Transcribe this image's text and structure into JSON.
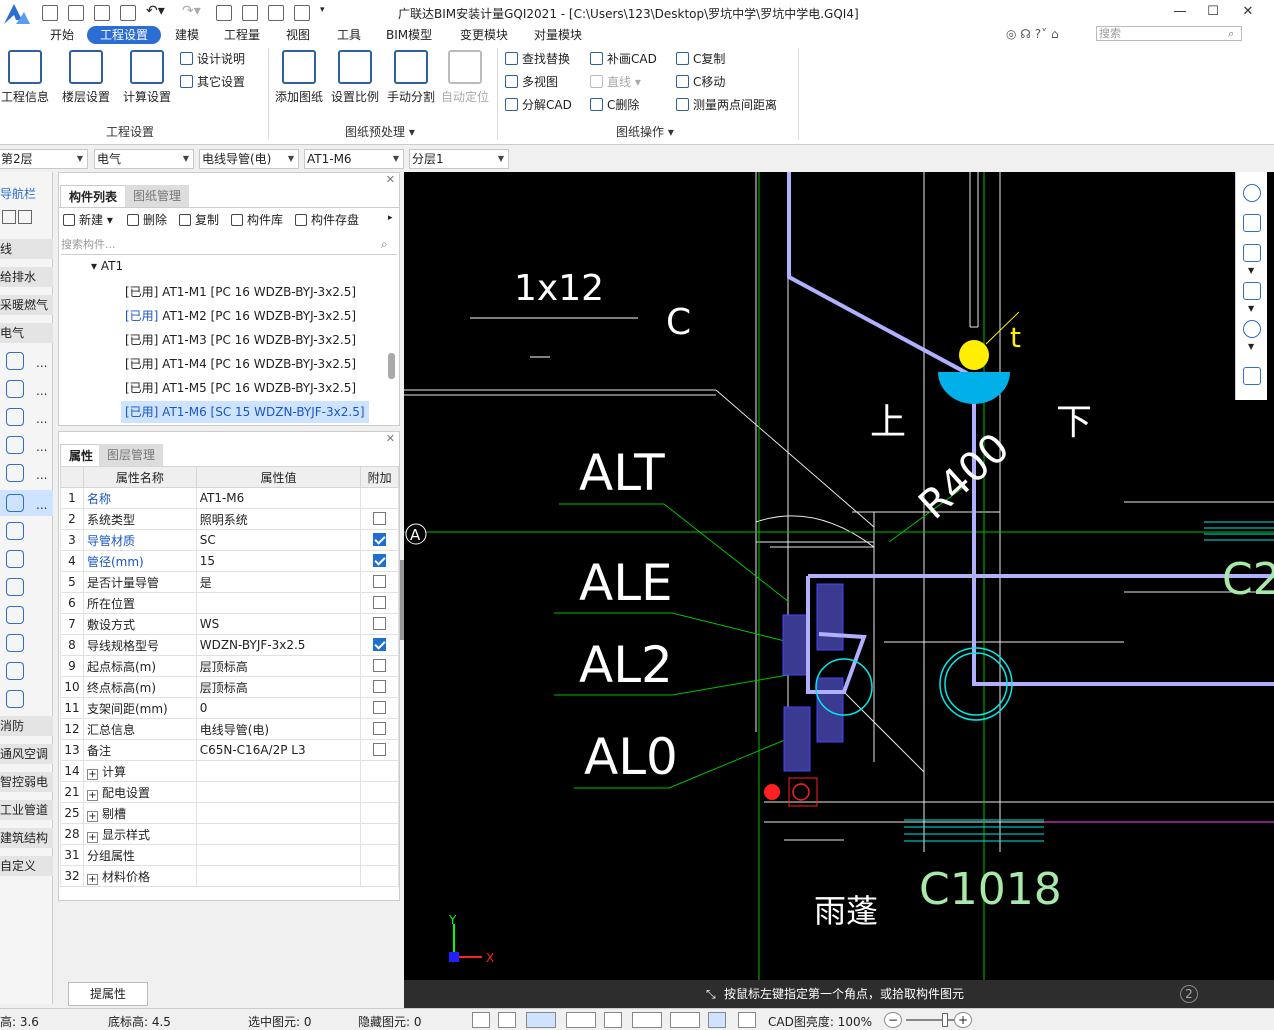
{
  "window": {
    "title": "广联达BIM安装计量GQI2021 - [C:\\Users\\123\\Desktop\\罗坑中学\\罗坑中学电.GQI4]",
    "search_placeholder": "搜索"
  },
  "menu": [
    "开始",
    "工程设置",
    "建模",
    "工程量",
    "视图",
    "工具",
    "BIM模型",
    "变更模块",
    "对量模块"
  ],
  "menu_active": "工程设置",
  "ribbon": {
    "group1": {
      "buttons": [
        "工程信息",
        "楼层设置",
        "计算设置"
      ],
      "small": [
        "设计说明",
        "其它设置"
      ],
      "label": "工程设置"
    },
    "group2": {
      "buttons": [
        "添加图纸",
        "设置比例",
        "手动分割",
        "自动定位"
      ],
      "label": "图纸预处理"
    },
    "group3": {
      "col1": [
        "查找替换",
        "多视图",
        "分解CAD"
      ],
      "col2": [
        "补画CAD",
        "直线",
        "C删除"
      ],
      "col3": [
        "C复制",
        "C移动",
        "测量两点间距离"
      ],
      "label": "图纸操作"
    }
  },
  "combos": [
    "第2层",
    "电气",
    "电线导管(电)",
    "AT1-M6",
    "分层1"
  ],
  "nav": {
    "title": "导航栏",
    "items": [
      "线",
      "给排水",
      "采暖燃气",
      "电气"
    ],
    "bottom_items": [
      "消防",
      "通风空调",
      "智控弱电",
      "工业管道",
      "建筑结构",
      "自定义"
    ],
    "dots": "..."
  },
  "component_list": {
    "tabs": [
      "构件列表",
      "图纸管理"
    ],
    "toolbar": [
      "新建",
      "删除",
      "复制",
      "构件库",
      "构件存盘"
    ],
    "search_placeholder": "搜索构件...",
    "root": "AT1",
    "items": [
      "[已用] AT1-M1 [PC 16 WDZB-BYJ-3x2.5]",
      "[已用] AT1-M2 [PC 16 WDZB-BYJ-3x2.5]",
      "[已用] AT1-M3 [PC 16 WDZB-BYJ-3x2.5]",
      "[已用] AT1-M4 [PC 16 WDZB-BYJ-3x2.5]",
      "[已用] AT1-M5 [PC 16 WDZB-BYJ-3x2.5]",
      "[已用] AT1-M6 [SC 15 WDZN-BYJF-3x2.5]"
    ]
  },
  "properties": {
    "tabs": [
      "属性",
      "图层管理"
    ],
    "headers": [
      "属性名称",
      "属性值",
      "附加"
    ],
    "rows": [
      {
        "n": "1",
        "k": "名称",
        "v": "AT1-M6",
        "blue": true,
        "cb": "none"
      },
      {
        "n": "2",
        "k": "系统类型",
        "v": "照明系统",
        "blue": false,
        "cb": "off"
      },
      {
        "n": "3",
        "k": "导管材质",
        "v": "SC",
        "blue": true,
        "cb": "on"
      },
      {
        "n": "4",
        "k": "管径(mm)",
        "v": "15",
        "blue": true,
        "cb": "on"
      },
      {
        "n": "5",
        "k": "是否计量导管",
        "v": "是",
        "blue": false,
        "cb": "off"
      },
      {
        "n": "6",
        "k": "所在位置",
        "v": "",
        "blue": false,
        "cb": "off"
      },
      {
        "n": "7",
        "k": "敷设方式",
        "v": "WS",
        "blue": false,
        "cb": "off"
      },
      {
        "n": "8",
        "k": "导线规格型号",
        "v": "WDZN-BYJF-3x2.5",
        "blue": false,
        "cb": "on"
      },
      {
        "n": "9",
        "k": "起点标高(m)",
        "v": "层顶标高",
        "blue": false,
        "cb": "off"
      },
      {
        "n": "10",
        "k": "终点标高(m)",
        "v": "层顶标高",
        "blue": false,
        "cb": "off"
      },
      {
        "n": "11",
        "k": "支架间距(mm)",
        "v": "0",
        "blue": false,
        "cb": "off"
      },
      {
        "n": "12",
        "k": "汇总信息",
        "v": "电线导管(电)",
        "blue": false,
        "cb": "off"
      },
      {
        "n": "13",
        "k": "备注",
        "v": "C65N-C16A/2P L3",
        "blue": false,
        "cb": "off"
      },
      {
        "n": "14",
        "k": "计算",
        "v": "",
        "blue": false,
        "cb": "none",
        "expand": true
      },
      {
        "n": "21",
        "k": "配电设置",
        "v": "",
        "blue": false,
        "cb": "none",
        "expand": true
      },
      {
        "n": "25",
        "k": "剔槽",
        "v": "",
        "blue": false,
        "cb": "none",
        "expand": true
      },
      {
        "n": "28",
        "k": "显示样式",
        "v": "",
        "blue": false,
        "cb": "none",
        "expand": true
      },
      {
        "n": "31",
        "k": "分组属性",
        "v": "",
        "blue": false,
        "cb": "none"
      },
      {
        "n": "32",
        "k": "材料价格",
        "v": "",
        "blue": false,
        "cb": "none",
        "expand": true
      }
    ],
    "button": "提属性"
  },
  "canvas": {
    "labels": [
      "1x12",
      "C",
      "ALT",
      "ALE",
      "AL2",
      "AL0",
      "R400",
      "C1018",
      "雨蓬",
      "上",
      "下",
      "t",
      "A",
      "C2"
    ],
    "axis_y": "Y",
    "axis_x": "X",
    "command": "按鼠标左键指定第一个角点，或拾取构件图元",
    "badge": "2"
  },
  "status": {
    "floor_height": "高: 3.6",
    "base_height": "底标高: 4.5",
    "selected": "选中图元: 0",
    "hidden": "隐藏图元: 0",
    "cad_brightness": "CAD图亮度: 100%"
  }
}
